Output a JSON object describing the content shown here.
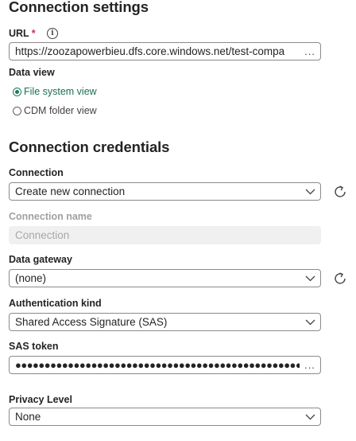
{
  "connection_settings": {
    "heading": "Connection settings",
    "url_label": "URL",
    "url_required_mark": "*",
    "url_value": "https://zoozapowerbieu.dfs.core.windows.net/test-compa",
    "url_more": "...",
    "data_view_label": "Data view",
    "data_view_options": [
      {
        "label": "File system view",
        "selected": true
      },
      {
        "label": "CDM folder view",
        "selected": false
      }
    ]
  },
  "connection_credentials": {
    "heading": "Connection credentials",
    "connection_label": "Connection",
    "connection_value": "Create new connection",
    "connection_name_label": "Connection name",
    "connection_name_placeholder": "Connection",
    "data_gateway_label": "Data gateway",
    "data_gateway_value": "(none)",
    "auth_kind_label": "Authentication kind",
    "auth_kind_value": "Shared Access Signature (SAS)",
    "sas_token_label": "SAS token",
    "sas_token_value": "●●●●●●●●●●●●●●●●●●●●●●●●●●●●●●●●●●●●●●●●●●●●●●●●●●●",
    "sas_more": "...",
    "privacy_label": "Privacy Level",
    "privacy_value": "None"
  },
  "icons": {
    "info": "info-icon",
    "chevron": "chevron-down-icon",
    "refresh": "refresh-icon"
  },
  "colors": {
    "accent": "#1e7a5e",
    "required": "#c4314b",
    "disabled_bg": "#f0f0f0"
  }
}
